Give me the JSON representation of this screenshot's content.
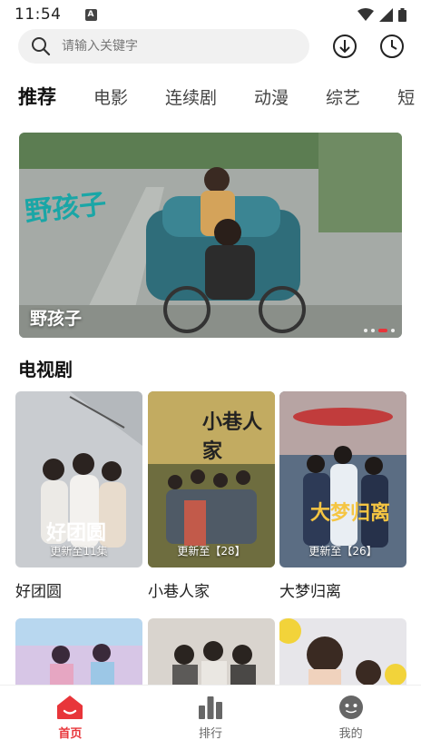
{
  "status_bar": {
    "time": "11:54",
    "notification_icon": "a-icon"
  },
  "search": {
    "placeholder": "请输入关键字"
  },
  "tabs": [
    {
      "label": "推荐",
      "active": true
    },
    {
      "label": "电影"
    },
    {
      "label": "连续剧"
    },
    {
      "label": "动漫"
    },
    {
      "label": "综艺"
    },
    {
      "label": "短"
    }
  ],
  "banner": {
    "title": "野孩子",
    "logo_text": "野孩子",
    "slide_count": 4,
    "active_slide": 3
  },
  "section": {
    "title": "电视剧"
  },
  "cards": [
    {
      "title": "好团圆",
      "badge": "更新至11集",
      "poster_text": "好团圆"
    },
    {
      "title": "小巷人家",
      "badge": "更新至【28】",
      "poster_text": "小巷人家"
    },
    {
      "title": "大梦归离",
      "badge": "更新至【26】",
      "poster_text": "大梦归离"
    }
  ],
  "bottom_nav": [
    {
      "label": "首页",
      "icon": "home-icon",
      "active": true
    },
    {
      "label": "排行",
      "icon": "ranking-icon"
    },
    {
      "label": "我的",
      "icon": "profile-icon"
    }
  ],
  "colors": {
    "accent": "#e8353a",
    "search_bg": "#f1f1f1",
    "text": "#222222"
  }
}
